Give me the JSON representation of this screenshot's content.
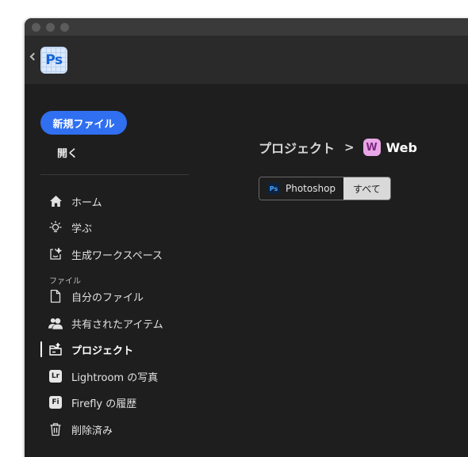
{
  "app": {
    "logo_text": "Ps"
  },
  "sidebar": {
    "new_file_label": "新規ファイル",
    "open_label": "開く",
    "items": [
      {
        "label": "ホーム",
        "icon": "home-icon"
      },
      {
        "label": "学ぶ",
        "icon": "lightbulb-icon"
      },
      {
        "label": "生成ワークスペース",
        "icon": "generative-workspace-icon"
      },
      {
        "label": "自分のファイル",
        "icon": "file-icon"
      },
      {
        "label": "共有されたアイテム",
        "icon": "shared-people-icon"
      },
      {
        "label": "プロジェクト",
        "icon": "projects-icon",
        "active": true
      },
      {
        "label": "Lightroom の写真",
        "icon": "lightroom-icon",
        "badge": "Lr"
      },
      {
        "label": "Firefly の履歴",
        "icon": "firefly-icon",
        "badge": "Fi"
      },
      {
        "label": "削除済み",
        "icon": "trash-icon"
      }
    ],
    "section_files_label": "ファイル"
  },
  "main": {
    "breadcrumb": {
      "root": "プロジェクト",
      "separator": ">",
      "current_icon_letter": "W",
      "current": "Web"
    },
    "filters": {
      "photoshop_badge": "Ps",
      "photoshop_label": "Photoshop",
      "all_label": "すべて",
      "selected": "すべて"
    }
  }
}
